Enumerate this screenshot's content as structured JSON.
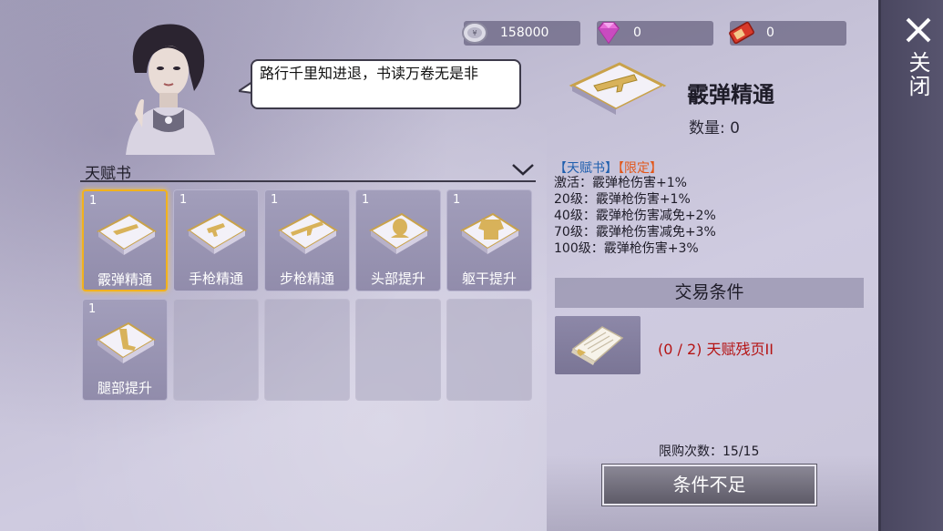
{
  "currencies": [
    {
      "icon": "silver-coin-icon",
      "value": "158000"
    },
    {
      "icon": "diamond-icon",
      "value": "0"
    },
    {
      "icon": "ticket-icon",
      "value": "0"
    }
  ],
  "speech": "路行千里知进退，书读万卷无是非",
  "category": {
    "label": "天赋书"
  },
  "grid": [
    {
      "count": "1",
      "name": "霰弹精通",
      "selected": true
    },
    {
      "count": "1",
      "name": "手枪精通"
    },
    {
      "count": "1",
      "name": "步枪精通"
    },
    {
      "count": "1",
      "name": "头部提升"
    },
    {
      "count": "1",
      "name": "躯干提升"
    },
    {
      "count": "1",
      "name": "腿部提升"
    }
  ],
  "detail": {
    "name": "霰弹精通",
    "quantity": "数量: 0",
    "tag_book": "【天赋书】",
    "tag_limited": "【限定】",
    "effects": [
      "激活：霰弹枪伤害+1%",
      "20级：霰弹枪伤害+1%",
      "40级：霰弹枪伤害减免+2%",
      "70级：霰弹枪伤害减免+3%",
      "100级：霰弹枪伤害+3%"
    ]
  },
  "trade": {
    "header": "交易条件",
    "requirement": "(0 / 2) 天赋残页II"
  },
  "limit": "限购次数：15/15",
  "buy_button": "条件不足",
  "close_label": "关闭",
  "colors": {
    "accent_gold": "#f2b21e",
    "requirement_red": "#b51313",
    "tag_blue": "#1f5fae",
    "tag_orange": "#e2571a"
  }
}
